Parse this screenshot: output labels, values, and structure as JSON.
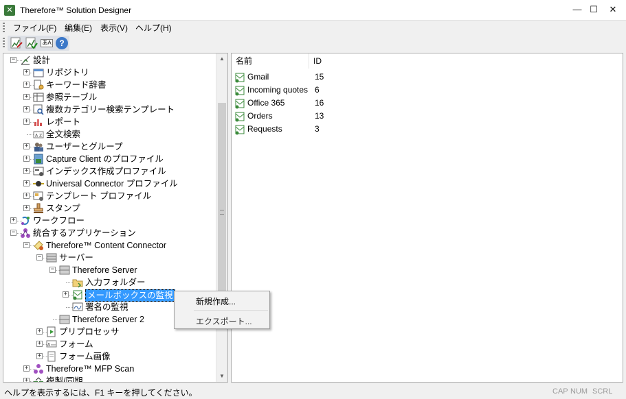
{
  "window": {
    "title": "Therefore™ Solution Designer",
    "minimize": "—",
    "maximize": "☐",
    "close": "✕"
  },
  "menu": [
    {
      "label": "ファイル(F)"
    },
    {
      "label": "編集(E)"
    },
    {
      "label": "表示(V)"
    },
    {
      "label": "ヘルプ(H)"
    }
  ],
  "toolbar": {
    "buttons": [
      {
        "icon": "design-edit-icon"
      },
      {
        "icon": "design-check-icon"
      },
      {
        "icon": "translate-icon",
        "label": "あA"
      },
      {
        "icon": "help-icon",
        "label": "?"
      }
    ]
  },
  "tree": [
    {
      "label": "設計",
      "expander": "−"
    },
    {
      "label": "リポジトリ",
      "expander": "+"
    },
    {
      "label": "キーワード辞書",
      "expander": "+"
    },
    {
      "label": "参照テーブル",
      "expander": "+"
    },
    {
      "label": "複数カテゴリー検索テンプレート",
      "expander": "+"
    },
    {
      "label": "レポート",
      "expander": "+"
    },
    {
      "label": "全文検索",
      "expander": "",
      "icon_text": "A Z"
    },
    {
      "label": "ユーザーとグループ",
      "expander": "+"
    },
    {
      "label": "Capture Client のプロファイル",
      "expander": "+"
    },
    {
      "label": "インデックス作成プロファイル",
      "expander": "+"
    },
    {
      "label": "Universal Connector プロファイル",
      "expander": "+"
    },
    {
      "label": "テンプレート プロファイル",
      "expander": "+"
    },
    {
      "label": "スタンプ",
      "expander": "+"
    },
    {
      "label": "ワークフロー",
      "expander": "+"
    },
    {
      "label": "統合するアプリケーション",
      "expander": "−"
    },
    {
      "label": "Therefore™ Content Connector",
      "expander": "−"
    },
    {
      "label": "サーバー",
      "expander": "−"
    },
    {
      "label": "Therefore Server",
      "expander": "−"
    },
    {
      "label": "入力フォルダー",
      "expander": ""
    },
    {
      "label": "メールボックスの監視",
      "expander": "+",
      "selected": true
    },
    {
      "label": "署名の監視",
      "expander": ""
    },
    {
      "label": "Therefore Server 2",
      "expander": ""
    },
    {
      "label": "プリプロセッサ",
      "expander": "+"
    },
    {
      "label": "フォーム",
      "expander": "+"
    },
    {
      "label": "フォーム画像",
      "expander": "+"
    },
    {
      "label": "Therefore™ MFP Scan",
      "expander": "+"
    },
    {
      "label": "複製/同期",
      "expander": "+"
    }
  ],
  "list": {
    "columns": [
      "名前",
      "ID"
    ],
    "rows": [
      {
        "name": "Gmail",
        "id": "15"
      },
      {
        "name": "Incoming quotes",
        "id": "6"
      },
      {
        "name": "Office 365",
        "id": "16"
      },
      {
        "name": "Orders",
        "id": "13"
      },
      {
        "name": "Requests",
        "id": "3"
      }
    ]
  },
  "context_menu": {
    "items": [
      "新規作成...",
      "エクスポート..."
    ]
  },
  "status": {
    "text": "ヘルプを表示するには、F1 キーを押してください。",
    "cap": "CAP",
    "num": "NUM",
    "scrl": "SCRL"
  }
}
